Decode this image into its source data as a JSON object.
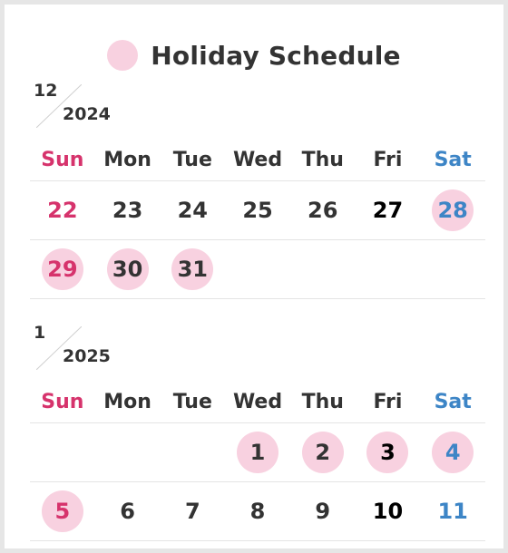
{
  "title": "Holiday Schedule",
  "colors": {
    "holiday_highlight": "#f8d1e0",
    "sunday": "#d6336c",
    "saturday": "#3d85c6",
    "text": "#333333"
  },
  "weekdays": [
    "Sun",
    "Mon",
    "Tue",
    "Wed",
    "Thu",
    "Fri",
    "Sat"
  ],
  "months": [
    {
      "month": "12",
      "year": "2024",
      "weeks": [
        [
          {
            "day": "22",
            "holiday": false
          },
          {
            "day": "23",
            "holiday": false
          },
          {
            "day": "24",
            "holiday": false
          },
          {
            "day": "25",
            "holiday": false
          },
          {
            "day": "26",
            "holiday": false
          },
          {
            "day": "27",
            "holiday": false
          },
          {
            "day": "28",
            "holiday": true
          }
        ],
        [
          {
            "day": "29",
            "holiday": true
          },
          {
            "day": "30",
            "holiday": true
          },
          {
            "day": "31",
            "holiday": true
          },
          {
            "day": "",
            "holiday": false
          },
          {
            "day": "",
            "holiday": false
          },
          {
            "day": "",
            "holiday": false
          },
          {
            "day": "",
            "holiday": false
          }
        ]
      ]
    },
    {
      "month": "1",
      "year": "2025",
      "weeks": [
        [
          {
            "day": "",
            "holiday": false
          },
          {
            "day": "",
            "holiday": false
          },
          {
            "day": "",
            "holiday": false
          },
          {
            "day": "1",
            "holiday": true
          },
          {
            "day": "2",
            "holiday": true
          },
          {
            "day": "3",
            "holiday": true
          },
          {
            "day": "4",
            "holiday": true
          }
        ],
        [
          {
            "day": "5",
            "holiday": true
          },
          {
            "day": "6",
            "holiday": false
          },
          {
            "day": "7",
            "holiday": false
          },
          {
            "day": "8",
            "holiday": false
          },
          {
            "day": "9",
            "holiday": false
          },
          {
            "day": "10",
            "holiday": false
          },
          {
            "day": "11",
            "holiday": false
          }
        ]
      ]
    }
  ]
}
